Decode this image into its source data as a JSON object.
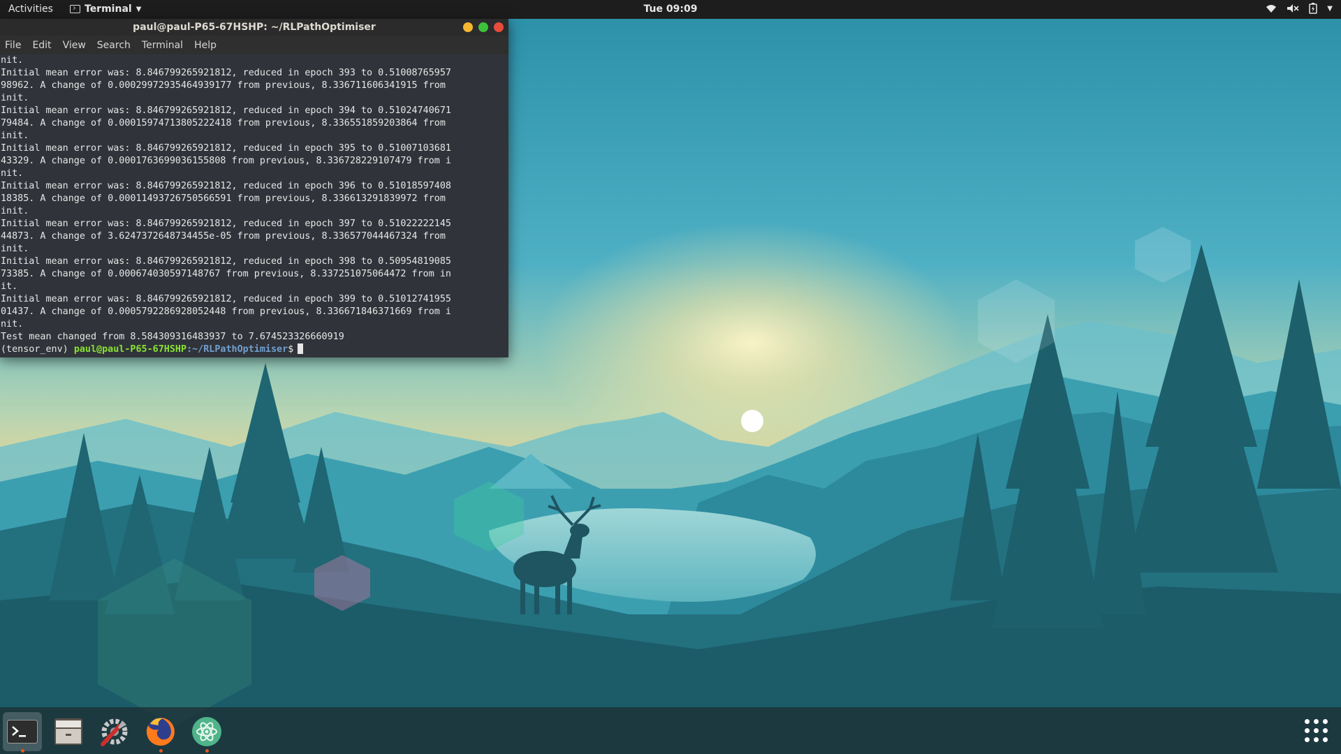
{
  "topbar": {
    "activities": "Activities",
    "app_menu": "Terminal",
    "clock": "Tue 09:09"
  },
  "terminal": {
    "title": "paul@paul-P65-67HSHP: ~/RLPathOptimiser",
    "menu": [
      "File",
      "Edit",
      "View",
      "Search",
      "Terminal",
      "Help"
    ],
    "output": "nit.\nInitial mean error was: 8.846799265921812, reduced in epoch 393 to 0.51008765957\n98962. A change of 0.00029972935464939177 from previous, 8.336711606341915 from\ninit.\nInitial mean error was: 8.846799265921812, reduced in epoch 394 to 0.51024740671\n79484. A change of 0.00015974713805222418 from previous, 8.336551859203864 from\ninit.\nInitial mean error was: 8.846799265921812, reduced in epoch 395 to 0.51007103681\n43329. A change of 0.0001763699036155808 from previous, 8.336728229107479 from i\nnit.\nInitial mean error was: 8.846799265921812, reduced in epoch 396 to 0.51018597408\n18385. A change of 0.00011493726750566591 from previous, 8.336613291839972 from\ninit.\nInitial mean error was: 8.846799265921812, reduced in epoch 397 to 0.51022222145\n44873. A change of 3.6247372648734455e-05 from previous, 8.336577044467324 from\ninit.\nInitial mean error was: 8.846799265921812, reduced in epoch 398 to 0.50954819085\n73385. A change of 0.000674030597148767 from previous, 8.337251075064472 from in\nit.\nInitial mean error was: 8.846799265921812, reduced in epoch 399 to 0.51012741955\n01437. A change of 0.0005792286928052448 from previous, 8.336671846371669 from i\nnit.\nTest mean changed from 8.584309316483937 to 7.674523326660919",
    "prompt_env": "(tensor_env) ",
    "prompt_user": "paul@paul-P65-67HSHP",
    "prompt_path": ":~/RLPathOptimiser",
    "prompt_symbol": "$"
  },
  "dock": {
    "items": [
      {
        "icon": "terminal-icon",
        "running": true,
        "active": true
      },
      {
        "icon": "files-icon",
        "running": false,
        "active": false
      },
      {
        "icon": "settings-tools-icon",
        "running": false,
        "active": false
      },
      {
        "icon": "firefox-icon",
        "running": true,
        "active": false
      },
      {
        "icon": "atom-icon",
        "running": true,
        "active": false
      }
    ]
  },
  "colors": {
    "accent": "#e95420",
    "close": "#e74c3c",
    "minimize": "#f5b82e",
    "maximize": "#3cc13b",
    "prompt_user": "#8ae234",
    "prompt_path": "#729fcf"
  }
}
